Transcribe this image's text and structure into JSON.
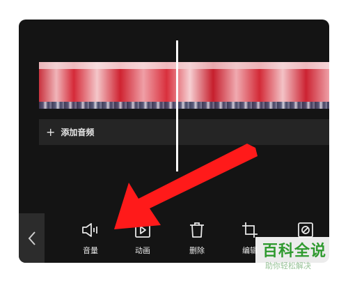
{
  "timeline": {
    "add_audio_label": "添加音频",
    "add_audio_icon": "plus-icon"
  },
  "toolbar": {
    "back_icon": "chevron-left-icon",
    "items": [
      {
        "label": "音量",
        "icon": "volume-icon"
      },
      {
        "label": "动画",
        "icon": "play-square-icon"
      },
      {
        "label": "删除",
        "icon": "trash-icon"
      },
      {
        "label": "编辑",
        "icon": "crop-icon"
      },
      {
        "label": "",
        "icon": "filter-circle-icon"
      }
    ]
  },
  "annotation": {
    "arrow_color": "#ff1a1a"
  },
  "watermark": {
    "title": "百科全说",
    "subtitle": "助你轻松解决"
  },
  "colors": {
    "panel_bg": "#141414",
    "row_bg": "#252525",
    "watermark_green": "#2f9a2f"
  }
}
